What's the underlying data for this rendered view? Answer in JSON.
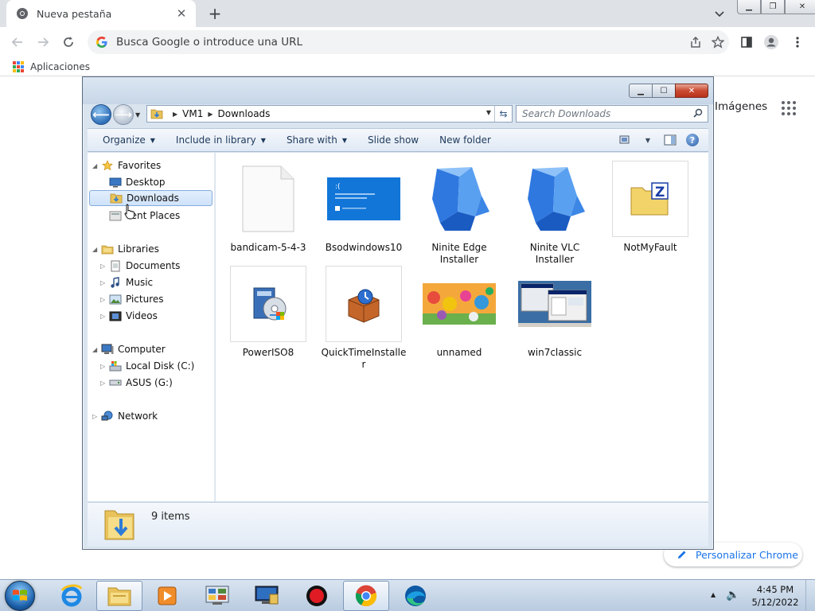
{
  "chrome": {
    "tab_title": "Nueva pestaña",
    "omnibox_placeholder": "Busca Google o introduce una URL",
    "bookmarks_apps": "Aplicaciones",
    "images_link": "Imágenes",
    "customize_label": "Personalizar Chrome"
  },
  "explorer": {
    "breadcrumb": [
      "VM1",
      "Downloads"
    ],
    "search_placeholder": "Search Downloads",
    "toolbar": {
      "organize": "Organize",
      "include_in_library": "Include in library",
      "share_with": "Share with",
      "slide_show": "Slide show",
      "new_folder": "New folder"
    },
    "nav": {
      "favorites": "Favorites",
      "desktop": "Desktop",
      "downloads": "Downloads",
      "recent_places": "cent Places",
      "libraries": "Libraries",
      "documents": "Documents",
      "music": "Music",
      "pictures": "Pictures",
      "videos": "Videos",
      "computer": "Computer",
      "local_disk": "Local Disk (C:)",
      "asus": "ASUS (G:)",
      "network": "Network"
    },
    "files": [
      {
        "name": "bandicam-5-4-3"
      },
      {
        "name": "Bsodwindows10"
      },
      {
        "name": "Ninite Edge Installer"
      },
      {
        "name": "Ninite VLC Installer"
      },
      {
        "name": "NotMyFault"
      },
      {
        "name": "PowerISO8"
      },
      {
        "name": "QuickTimeInstaller"
      },
      {
        "name": "unnamed"
      },
      {
        "name": "win7classic"
      }
    ],
    "status_count": "9 items"
  },
  "taskbar": {
    "time": "4:45 PM",
    "date": "5/12/2022"
  },
  "colors": {
    "chrome_accent": "#1a73e8",
    "explorer_selection": "#cfe2fa",
    "close_red": "#c94a32"
  }
}
